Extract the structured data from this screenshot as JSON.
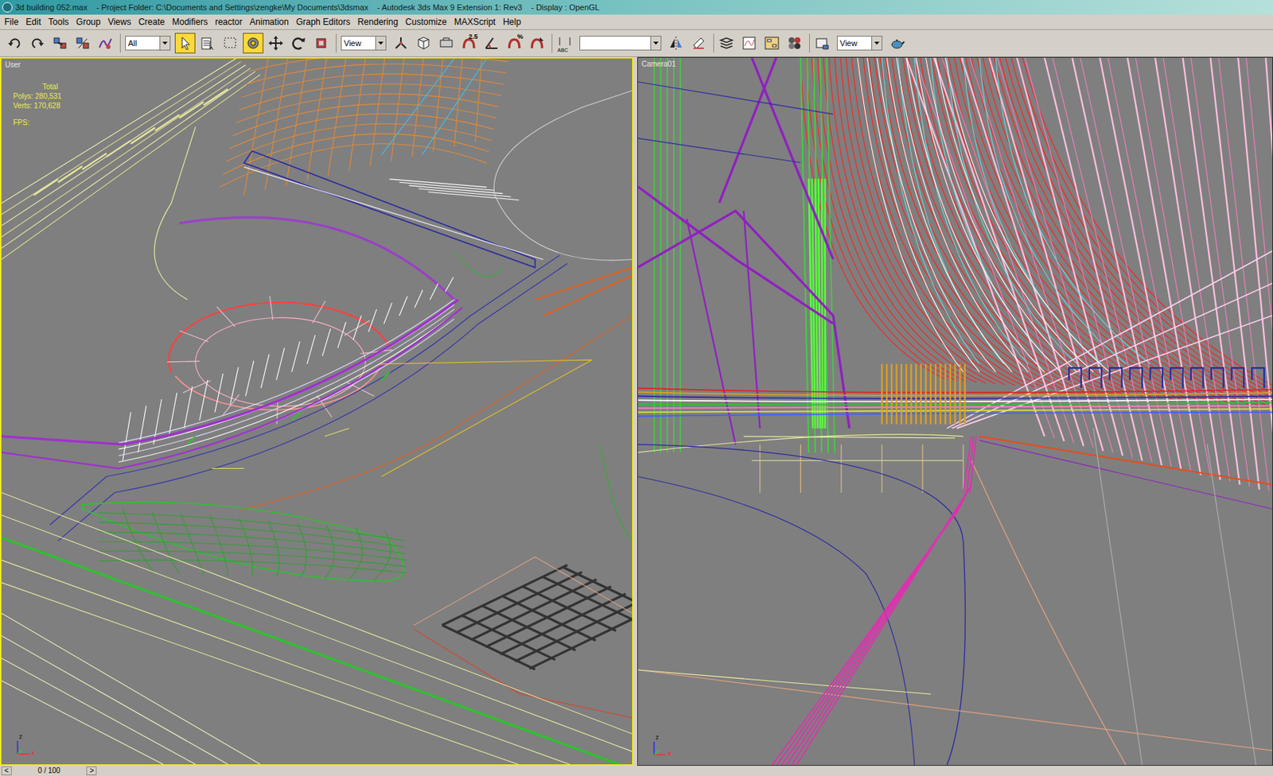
{
  "window": {
    "title": "3d building 052.max    - Project Folder: C:\\Documents and Settings\\zengke\\My Documents\\3dsmax    - Autodesk 3ds Max 9 Extension 1: Rev3    - Display : OpenGL"
  },
  "menu": [
    "File",
    "Edit",
    "Tools",
    "Group",
    "Views",
    "Create",
    "Modifiers",
    "reactor",
    "Animation",
    "Graph Editors",
    "Rendering",
    "Customize",
    "MAXScript",
    "Help"
  ],
  "toolbar": [
    {
      "name": "undo",
      "kind": "button",
      "selected": false
    },
    {
      "name": "redo",
      "kind": "button",
      "selected": false
    },
    {
      "name": "select-link",
      "kind": "button",
      "selected": false
    },
    {
      "name": "unlink",
      "kind": "button",
      "selected": false
    },
    {
      "name": "bind-space-warp",
      "kind": "button",
      "selected": false
    },
    {
      "name": "selection-filter",
      "kind": "dropdown",
      "text": "All"
    },
    {
      "name": "select-object",
      "kind": "button",
      "selected": true
    },
    {
      "name": "select-by-name",
      "kind": "button",
      "selected": false
    },
    {
      "name": "rectangle-region",
      "kind": "button",
      "selected": false
    },
    {
      "name": "window-crossing",
      "kind": "button",
      "selected": true
    },
    {
      "name": "move",
      "kind": "button",
      "selected": false
    },
    {
      "name": "rotate",
      "kind": "button",
      "selected": false
    },
    {
      "name": "scale",
      "kind": "button",
      "selected": false
    },
    {
      "name": "reference-coordinate",
      "kind": "dropdown",
      "text": "View"
    },
    {
      "name": "pivot-center",
      "kind": "button",
      "selected": false
    },
    {
      "name": "manipulate",
      "kind": "button",
      "selected": false
    },
    {
      "name": "keyboard-override",
      "kind": "button",
      "selected": false
    },
    {
      "name": "snaps-toggle",
      "kind": "button",
      "text": "2.5",
      "selected": false
    },
    {
      "name": "angle-snap",
      "kind": "button",
      "selected": false
    },
    {
      "name": "percent-snap",
      "kind": "button",
      "text": "%",
      "selected": false
    },
    {
      "name": "spinner-snap",
      "kind": "button",
      "selected": false
    },
    {
      "name": "edit-named-selections",
      "kind": "button",
      "text": "ABC",
      "selected": false
    },
    {
      "name": "named-selection-sets",
      "kind": "dropdown",
      "text": ""
    },
    {
      "name": "mirror",
      "kind": "button",
      "selected": false
    },
    {
      "name": "align",
      "kind": "button",
      "selected": false
    },
    {
      "name": "layer-manager",
      "kind": "button",
      "selected": false
    },
    {
      "name": "curve-editor",
      "kind": "button",
      "selected": false
    },
    {
      "name": "schematic-view",
      "kind": "button",
      "selected": false
    },
    {
      "name": "material-editor",
      "kind": "button",
      "selected": false
    },
    {
      "name": "render-scene",
      "kind": "button",
      "selected": false
    },
    {
      "name": "render-type",
      "kind": "dropdown",
      "text": "View"
    },
    {
      "name": "quick-render",
      "kind": "button",
      "selected": false
    }
  ],
  "viewports": [
    {
      "label": "User",
      "active": true,
      "stats": {
        "title": "Total",
        "polys": "Polys: 280,531",
        "verts": "Verts: 170,628",
        "fps": "FPS:"
      },
      "axes": [
        "z",
        "x"
      ]
    },
    {
      "label": "Camera01",
      "active": false,
      "axes": [
        "z",
        "x"
      ]
    }
  ],
  "timeline": {
    "text": "0 / 100",
    "prev": "<",
    "next": ">"
  }
}
